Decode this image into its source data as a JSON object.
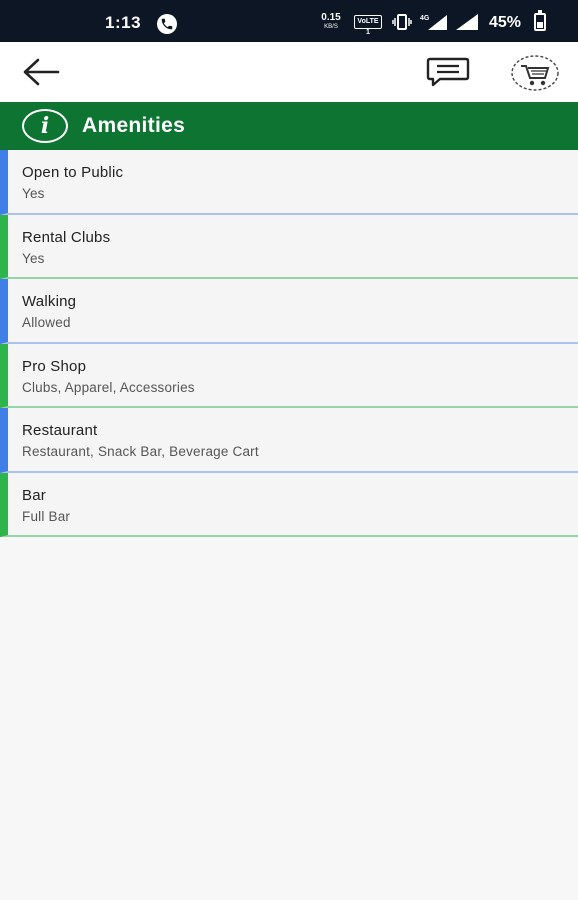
{
  "status_bar": {
    "time": "1:13",
    "net_speed_value": "0.15",
    "net_speed_unit": "KB/S",
    "volte_label": "VoLTE 1",
    "battery_percent": "45%",
    "battery_level": 0.45
  },
  "app_bar": {
    "back_icon": "arrow-left-icon",
    "chat_icon": "chat-icon",
    "cart_icon": "cart-icon"
  },
  "section": {
    "icon": "info-icon",
    "icon_glyph": "i",
    "title": "Amenities"
  },
  "colors": {
    "header_green": "#0d7432",
    "accent_blue": "#3f7fe6",
    "accent_green": "#2eb34d",
    "status_bar_bg": "#0c1624"
  },
  "amenities": [
    {
      "title": "Open to Public",
      "value": "Yes"
    },
    {
      "title": "Rental Clubs",
      "value": "Yes"
    },
    {
      "title": "Walking",
      "value": "Allowed"
    },
    {
      "title": "Pro Shop",
      "value": "Clubs, Apparel, Accessories"
    },
    {
      "title": "Restaurant",
      "value": "Restaurant, Snack Bar, Beverage Cart"
    },
    {
      "title": "Bar",
      "value": "Full Bar"
    }
  ]
}
